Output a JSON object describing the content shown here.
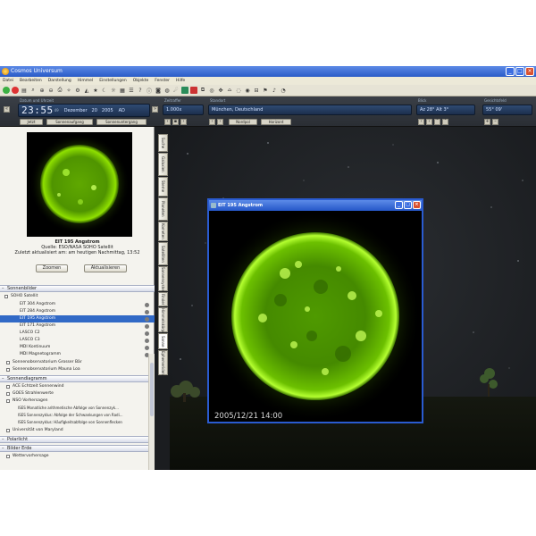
{
  "window": {
    "title": "Cosmos Universum"
  },
  "menu": [
    "Datei",
    "Bearbeiten",
    "Darstellung",
    "Himmel",
    "Einstellungen",
    "Objekte",
    "Fenster",
    "Hilfe"
  ],
  "controls": {
    "datetime_label": "Datum und Uhrzeit",
    "time": "23:55",
    "seconds": "49",
    "month": "Dezember",
    "day": "20",
    "year": "2005",
    "era": "AD",
    "speed_label": "Zeitraffer",
    "speed_value": "1.000x",
    "location_label": "Standort",
    "location_value": "München, Deutschland",
    "view_label": "Blick",
    "view_value": "Az 28° Alt 3°",
    "fov_label": "Gesichtsfeld",
    "fov_value": "55° 09'",
    "buttons": {
      "now": "Jetzt",
      "sunrise": "Sonnenaufgang",
      "sunset": "Sonnenuntergang",
      "north": "Nordpol",
      "horizon": "Horizont"
    }
  },
  "preview": {
    "title": "EIT 195 Angstrom",
    "source": "Quelle: ESO/NASA SOHO Satellit",
    "updated": "Zuletzt aktualisiert am: am heutigen Nachmittag, 13:52",
    "zoom_button": "Zoomen",
    "refresh_button": "Aktualisieren",
    "overlay_text": "2005/12/21  14:00"
  },
  "tree": {
    "section1": "Sonnenbilder",
    "group1": "SOHO Satellit",
    "items": [
      "EIT 304 Angstrom",
      "EIT 284 Angstrom",
      "EIT 195 Angstrom",
      "EIT 171 Angstrom",
      "LASCO C2",
      "LASCO C3",
      "MDI Kontinuum",
      "MDI Magnetogramm"
    ],
    "extras": [
      "Sonnenobservatorium Grosser Bär",
      "Sonnenobservatorium Mauna Loa"
    ],
    "section2": "Sonnendiagramm",
    "diagrams": [
      "ACE Echtzeit Sonnenwind",
      "GOES Strahlenwerte",
      "NSO Vorhersagen",
      "ISES Monatliche arithmetische Abfolge von Sonnenzyk...",
      "ISES Sonnenzyklus: Abfolge der Schwankungen von Radi...",
      "ISES Sonnenzyklus: Häufigkeitsabfolge von Sonnenflecken"
    ],
    "extra2": "Universität von Maryland",
    "section3": "Polarlicht",
    "section4": "Bilder Erde",
    "item4": "Wettervorhersage"
  },
  "side_tabs": [
    "Suche",
    "Galaxien",
    "Sterne",
    "Planeten",
    "Kometen",
    "Satelliten",
    "Sonnensystem",
    "Finder",
    "Himmelskörper",
    "Sonne",
    "Ephemeriden"
  ],
  "solar_window": {
    "title": "EIT 195 Angstrom",
    "date": "2005/12/21  14:00"
  },
  "colors": {
    "sun_green": "#8fe000",
    "selection": "#3169c6",
    "titlebar": "#2a5bc7"
  }
}
